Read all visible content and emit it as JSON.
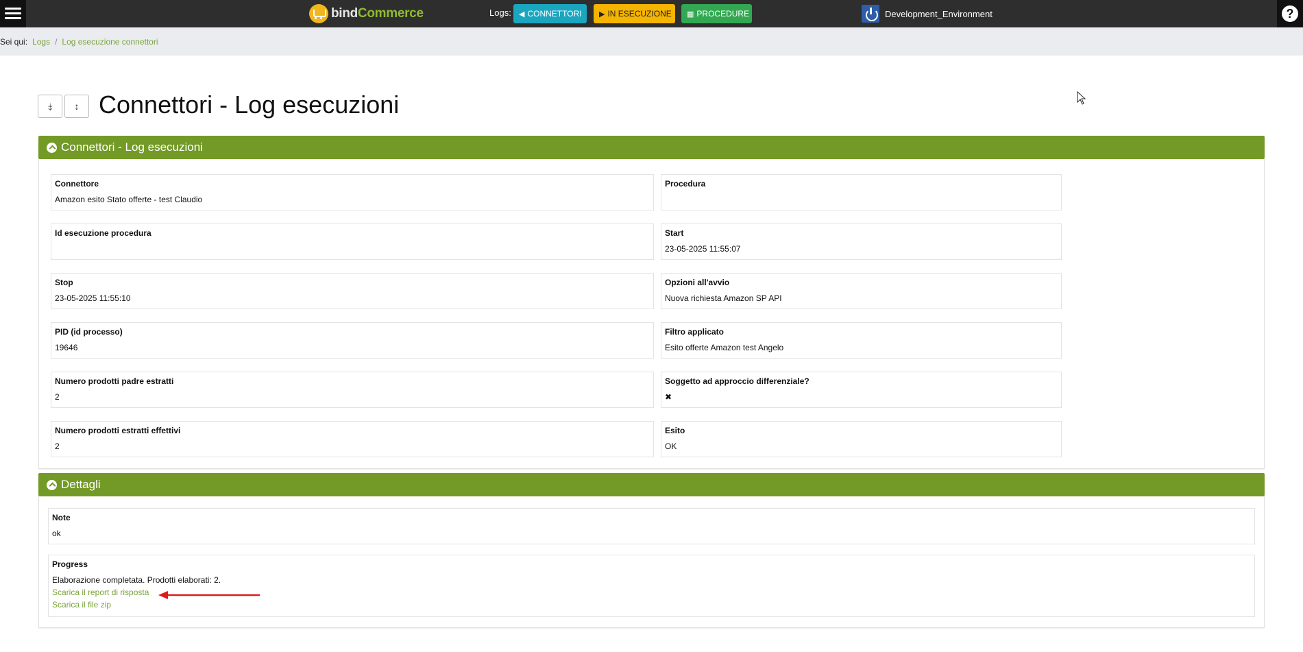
{
  "topbar": {
    "logo_part1": "bind",
    "logo_part2": "Commerce",
    "logs_label": "Logs:",
    "btn_connettori": "CONNETTORI",
    "btn_in_esecuzione": "IN ESECUZIONE",
    "btn_procedure": "PROCEDURE",
    "environment": "Development_Environment",
    "help": "?"
  },
  "breadcrumb": {
    "label": "Sei qui:",
    "items": [
      "Logs",
      "Log esecuzione connettori"
    ],
    "separator": "/"
  },
  "page": {
    "title": "Connettori - Log esecuzioni",
    "collapse_icon": "⤈",
    "expand_icon": "↕"
  },
  "panel1": {
    "title": "Connettori - Log esecuzioni",
    "fields": {
      "connettore": {
        "label": "Connettore",
        "value": "Amazon esito Stato offerte - test Claudio"
      },
      "procedura": {
        "label": "Procedura",
        "value": ""
      },
      "id_esecuzione": {
        "label": "Id esecuzione procedura",
        "value": ""
      },
      "start": {
        "label": "Start",
        "value": "23-05-2025 11:55:07"
      },
      "stop": {
        "label": "Stop",
        "value": "23-05-2025 11:55:10"
      },
      "opzioni": {
        "label": "Opzioni all'avvio",
        "value": "Nuova richiesta Amazon SP API"
      },
      "pid": {
        "label": "PID (id processo)",
        "value": "19646"
      },
      "filtro": {
        "label": "Filtro applicato",
        "value": "Esito offerte Amazon test Angelo"
      },
      "padre": {
        "label": "Numero prodotti padre estratti",
        "value": "2"
      },
      "differenziale": {
        "label": "Soggetto ad approccio differenziale?",
        "value": "✖"
      },
      "effettivi": {
        "label": "Numero prodotti estratti effettivi",
        "value": "2"
      },
      "esito": {
        "label": "Esito",
        "value": "OK"
      }
    }
  },
  "panel2": {
    "title": "Dettagli",
    "note": {
      "label": "Note",
      "value": "ok"
    },
    "progress": {
      "label": "Progress",
      "text": "Elaborazione completata. Prodotti elaborati: 2.",
      "link_report": "Scarica il report di risposta",
      "link_zip": "Scarica il file zip"
    }
  },
  "colors": {
    "accent_green": "#739a27",
    "link_green": "#7aa43a",
    "topbar": "#2e2e2e",
    "annotation_arrow": "#e01b1b"
  }
}
